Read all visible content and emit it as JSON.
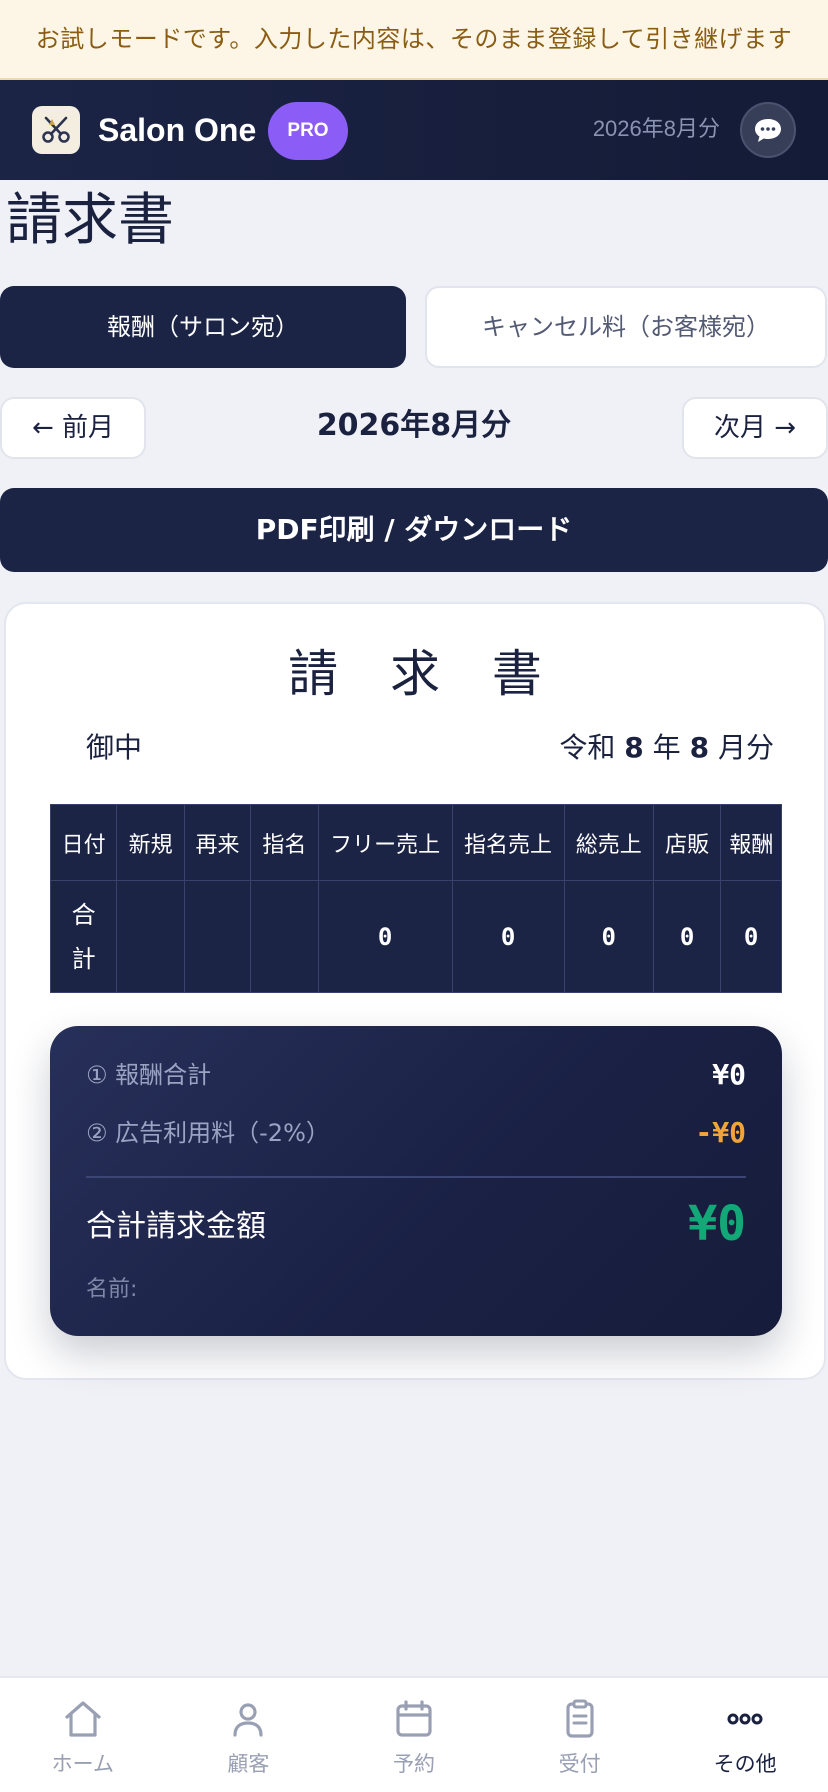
{
  "trial_banner": "お試しモードです。入力した内容は、そのまま登録して引き継げます",
  "header": {
    "app_name": "Salon One",
    "badge": "PRO",
    "month": "2026年8月分",
    "chat_icon": "speech-bubble-icon",
    "logo_icon": "scissors-icon"
  },
  "page": {
    "title": "請求書",
    "tabs": [
      {
        "label": "報酬（サロン宛）",
        "active": true
      },
      {
        "label": "キャンセル料（お客様宛）",
        "active": false
      }
    ],
    "prev_label": "← 前月",
    "next_label": "次月 →",
    "current_month": "2026年8月分",
    "pdf_button": "PDF印刷 / ダウンロード"
  },
  "invoice": {
    "title": "請 求 書",
    "recipient": "御中",
    "period": {
      "era": "令和",
      "year": "8",
      "year_unit": "年",
      "month": "8",
      "month_unit": "月分"
    },
    "table": {
      "headers": [
        "日付",
        "新規",
        "再来",
        "指名",
        "フリー売上",
        "指名売上",
        "総売上",
        "店販",
        "報酬"
      ],
      "total_row": {
        "label": "合計",
        "cells": [
          "",
          "",
          "",
          "0",
          "0",
          "0",
          "0",
          "0"
        ]
      }
    },
    "summary": {
      "fee_total_label": "① 報酬合計",
      "fee_total_value": "¥0",
      "ad_fee_label": "② 広告利用料（-2%）",
      "ad_fee_value": "-¥0",
      "grand_total_label": "合計請求金額",
      "grand_total_value": "¥0",
      "name_label": "名前:"
    }
  },
  "colors": {
    "navy": "#1c2446",
    "accent_purple": "#8b5cf6",
    "total_green": "#12a877",
    "ad_fee_orange": "#f2a33a",
    "banner_bg": "#fdf6e7"
  },
  "bottom_nav": [
    {
      "label": "ホーム",
      "icon": "home-icon",
      "active": false
    },
    {
      "label": "顧客",
      "icon": "person-icon",
      "active": false
    },
    {
      "label": "予約",
      "icon": "calendar-icon",
      "active": false
    },
    {
      "label": "受付",
      "icon": "clipboard-icon",
      "active": false
    },
    {
      "label": "その他",
      "icon": "more-dots-icon",
      "active": true
    }
  ]
}
